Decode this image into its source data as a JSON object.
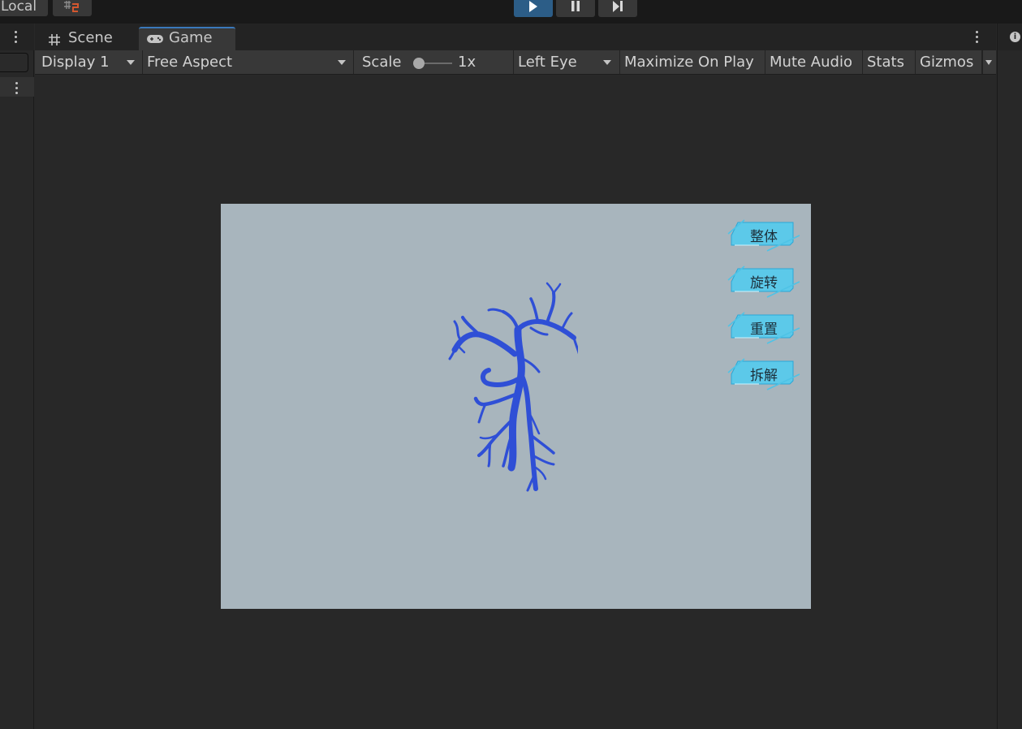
{
  "toolbar": {
    "pivot_label": "Local",
    "snap_icon": "grid-snap-icon",
    "play_icon": "play-icon",
    "pause_icon": "pause-icon",
    "step_icon": "step-icon"
  },
  "tabs": [
    {
      "label": "Scene",
      "icon": "hash-icon"
    },
    {
      "label": "Game",
      "icon": "gamepad-icon"
    }
  ],
  "game_toolbar": {
    "display": "Display 1",
    "aspect": "Free Aspect",
    "scale_label": "Scale",
    "scale_value": "1x",
    "eye": "Left Eye",
    "maximize": "Maximize On Play",
    "mute": "Mute Audio",
    "stats": "Stats",
    "gizmos": "Gizmos"
  },
  "game_buttons": [
    {
      "label": "整体"
    },
    {
      "label": "旋转"
    },
    {
      "label": "重置"
    },
    {
      "label": "拆解"
    }
  ],
  "colors": {
    "canvas_bg": "#a8b5bd",
    "vessel": "#2f4fd6",
    "button_cyan": "#4fc8e8",
    "play_active": "#2c5d87"
  }
}
